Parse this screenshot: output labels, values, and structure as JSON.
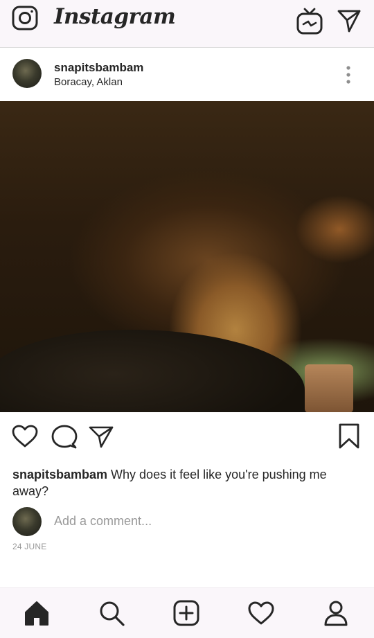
{
  "topbar": {
    "logo": "Instagram",
    "camera_icon": "camera-icon",
    "igtv_icon": "igtv-icon",
    "direct_icon": "paper-plane-icon"
  },
  "post": {
    "username": "snapitsbambam",
    "location": "Boracay, Aklan",
    "caption_user": "snapitsbambam",
    "caption_text": " Why does it feel like you're pushing me away?",
    "comment_placeholder": "Add a comment...",
    "date": "24 JUNE"
  },
  "bottom_nav": {
    "items": [
      "home-icon",
      "search-icon",
      "add-icon",
      "heart-icon",
      "profile-icon"
    ]
  },
  "colors": {
    "text": "#262626",
    "muted": "#999999",
    "bar_bg": "#faf6fa"
  }
}
